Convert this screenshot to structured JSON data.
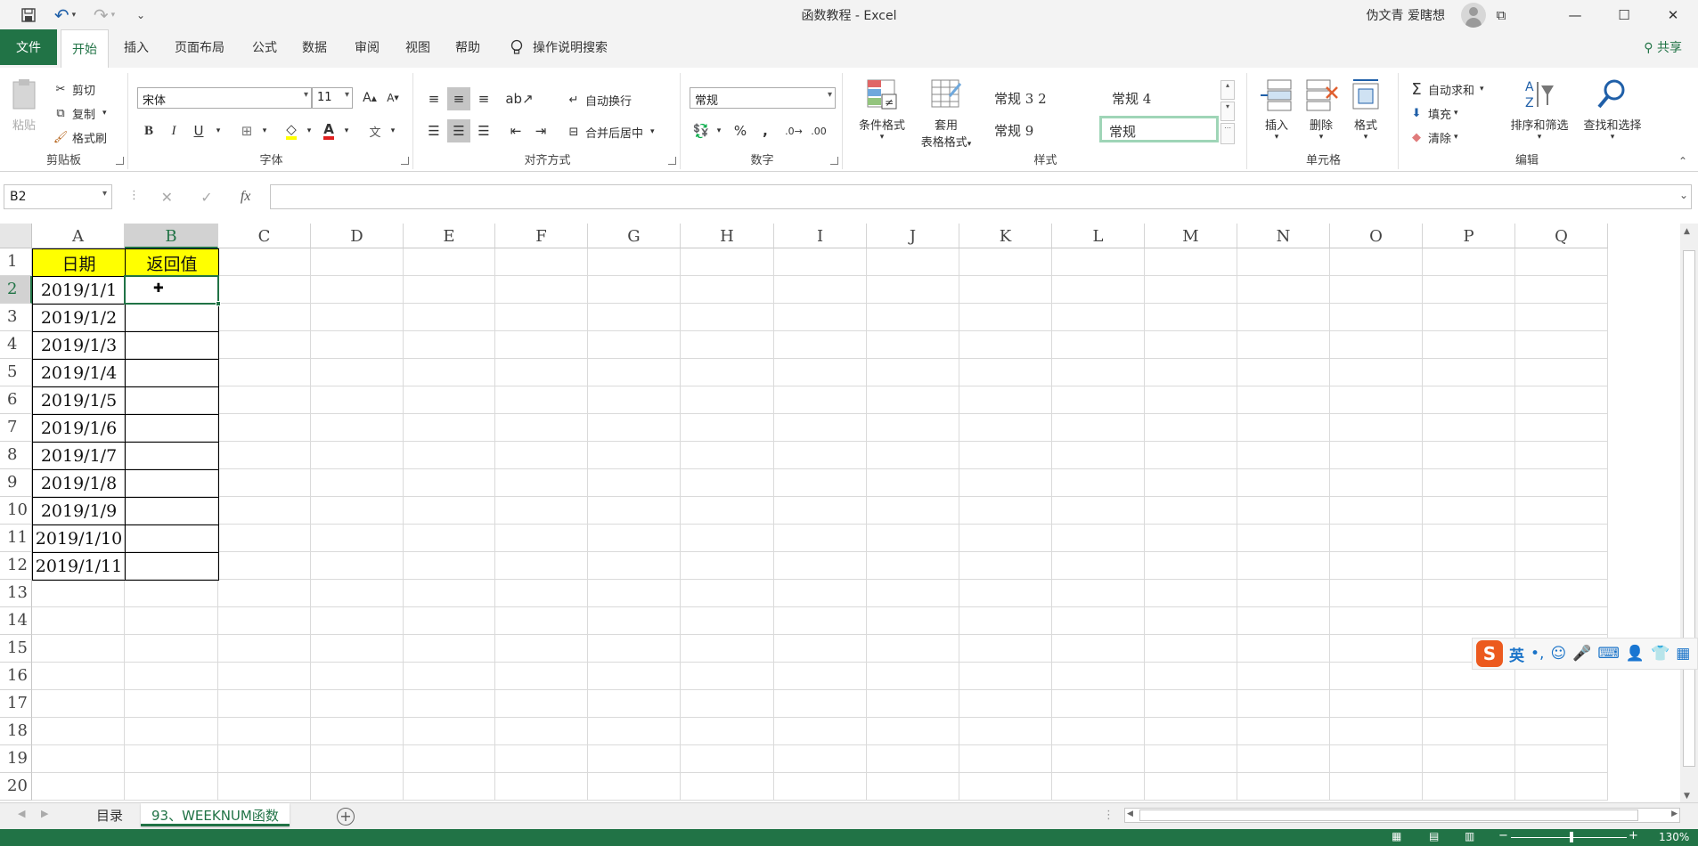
{
  "window": {
    "title": "函数教程  -  Excel",
    "user": "伪文青 爱瞎想",
    "minimize": "—",
    "maximize": "☐",
    "close": "✕",
    "restore_ribbon": "⧉"
  },
  "quick_access": {
    "save": "💾",
    "undo": "↶",
    "redo": "↷",
    "customize": "⌄"
  },
  "menu": {
    "file": "文件",
    "tabs": [
      "开始",
      "插入",
      "页面布局",
      "公式",
      "数据",
      "审阅",
      "视图",
      "帮助"
    ],
    "tell_me": "操作说明搜索",
    "share": "共享"
  },
  "ribbon": {
    "clipboard": {
      "label": "剪贴板",
      "paste": "粘贴",
      "cut": "剪切",
      "copy": "复制",
      "format_painter": "格式刷"
    },
    "font": {
      "label": "字体",
      "name": "宋体",
      "size": "11",
      "bold": "B",
      "italic": "I",
      "underline": "U"
    },
    "alignment": {
      "label": "对齐方式",
      "wrap": "自动换行",
      "merge": "合并后居中"
    },
    "number": {
      "label": "数字",
      "format": "常规",
      "percent": "%",
      "comma": ","
    },
    "styles": {
      "label": "样式",
      "conditional": "条件格式",
      "table_fmt_1": "套用",
      "table_fmt_2": "表格格式",
      "gallery": [
        "常规 3 2",
        "常规 4",
        "常规 9",
        "常规"
      ]
    },
    "cells": {
      "label": "单元格",
      "insert": "插入",
      "delete": "删除",
      "format": "格式"
    },
    "editing": {
      "label": "编辑",
      "autosum": "自动求和",
      "fill": "填充",
      "clear": "清除",
      "sort": "排序和筛选",
      "find": "查找和选择"
    }
  },
  "formula_bar": {
    "name_box": "B2",
    "cancel": "✕",
    "enter": "✓",
    "fx": "fx",
    "value": ""
  },
  "grid": {
    "columns": [
      "A",
      "B",
      "C",
      "D",
      "E",
      "F",
      "G",
      "H",
      "I",
      "J",
      "K",
      "L",
      "M",
      "N",
      "O",
      "P",
      "Q"
    ],
    "rows": [
      "1",
      "2",
      "3",
      "4",
      "5",
      "6",
      "7",
      "8",
      "9",
      "10",
      "11",
      "12",
      "13",
      "14",
      "15",
      "16",
      "17",
      "18",
      "19",
      "20"
    ],
    "header": {
      "a1": "日期",
      "b1": "返回值"
    },
    "dates": [
      "2019/1/1",
      "2019/1/2",
      "2019/1/3",
      "2019/1/4",
      "2019/1/5",
      "2019/1/6",
      "2019/1/7",
      "2019/1/8",
      "2019/1/9",
      "2019/1/10",
      "2019/1/11"
    ],
    "selected_cell": "B2",
    "header_fill": "#ffff00",
    "accent": "#217346"
  },
  "sheets": {
    "tabs": [
      "目录",
      "93、WEEKNUM函数"
    ],
    "active": "93、WEEKNUM函数"
  },
  "status": {
    "zoom": "130%"
  },
  "ime": {
    "lang": "英"
  }
}
